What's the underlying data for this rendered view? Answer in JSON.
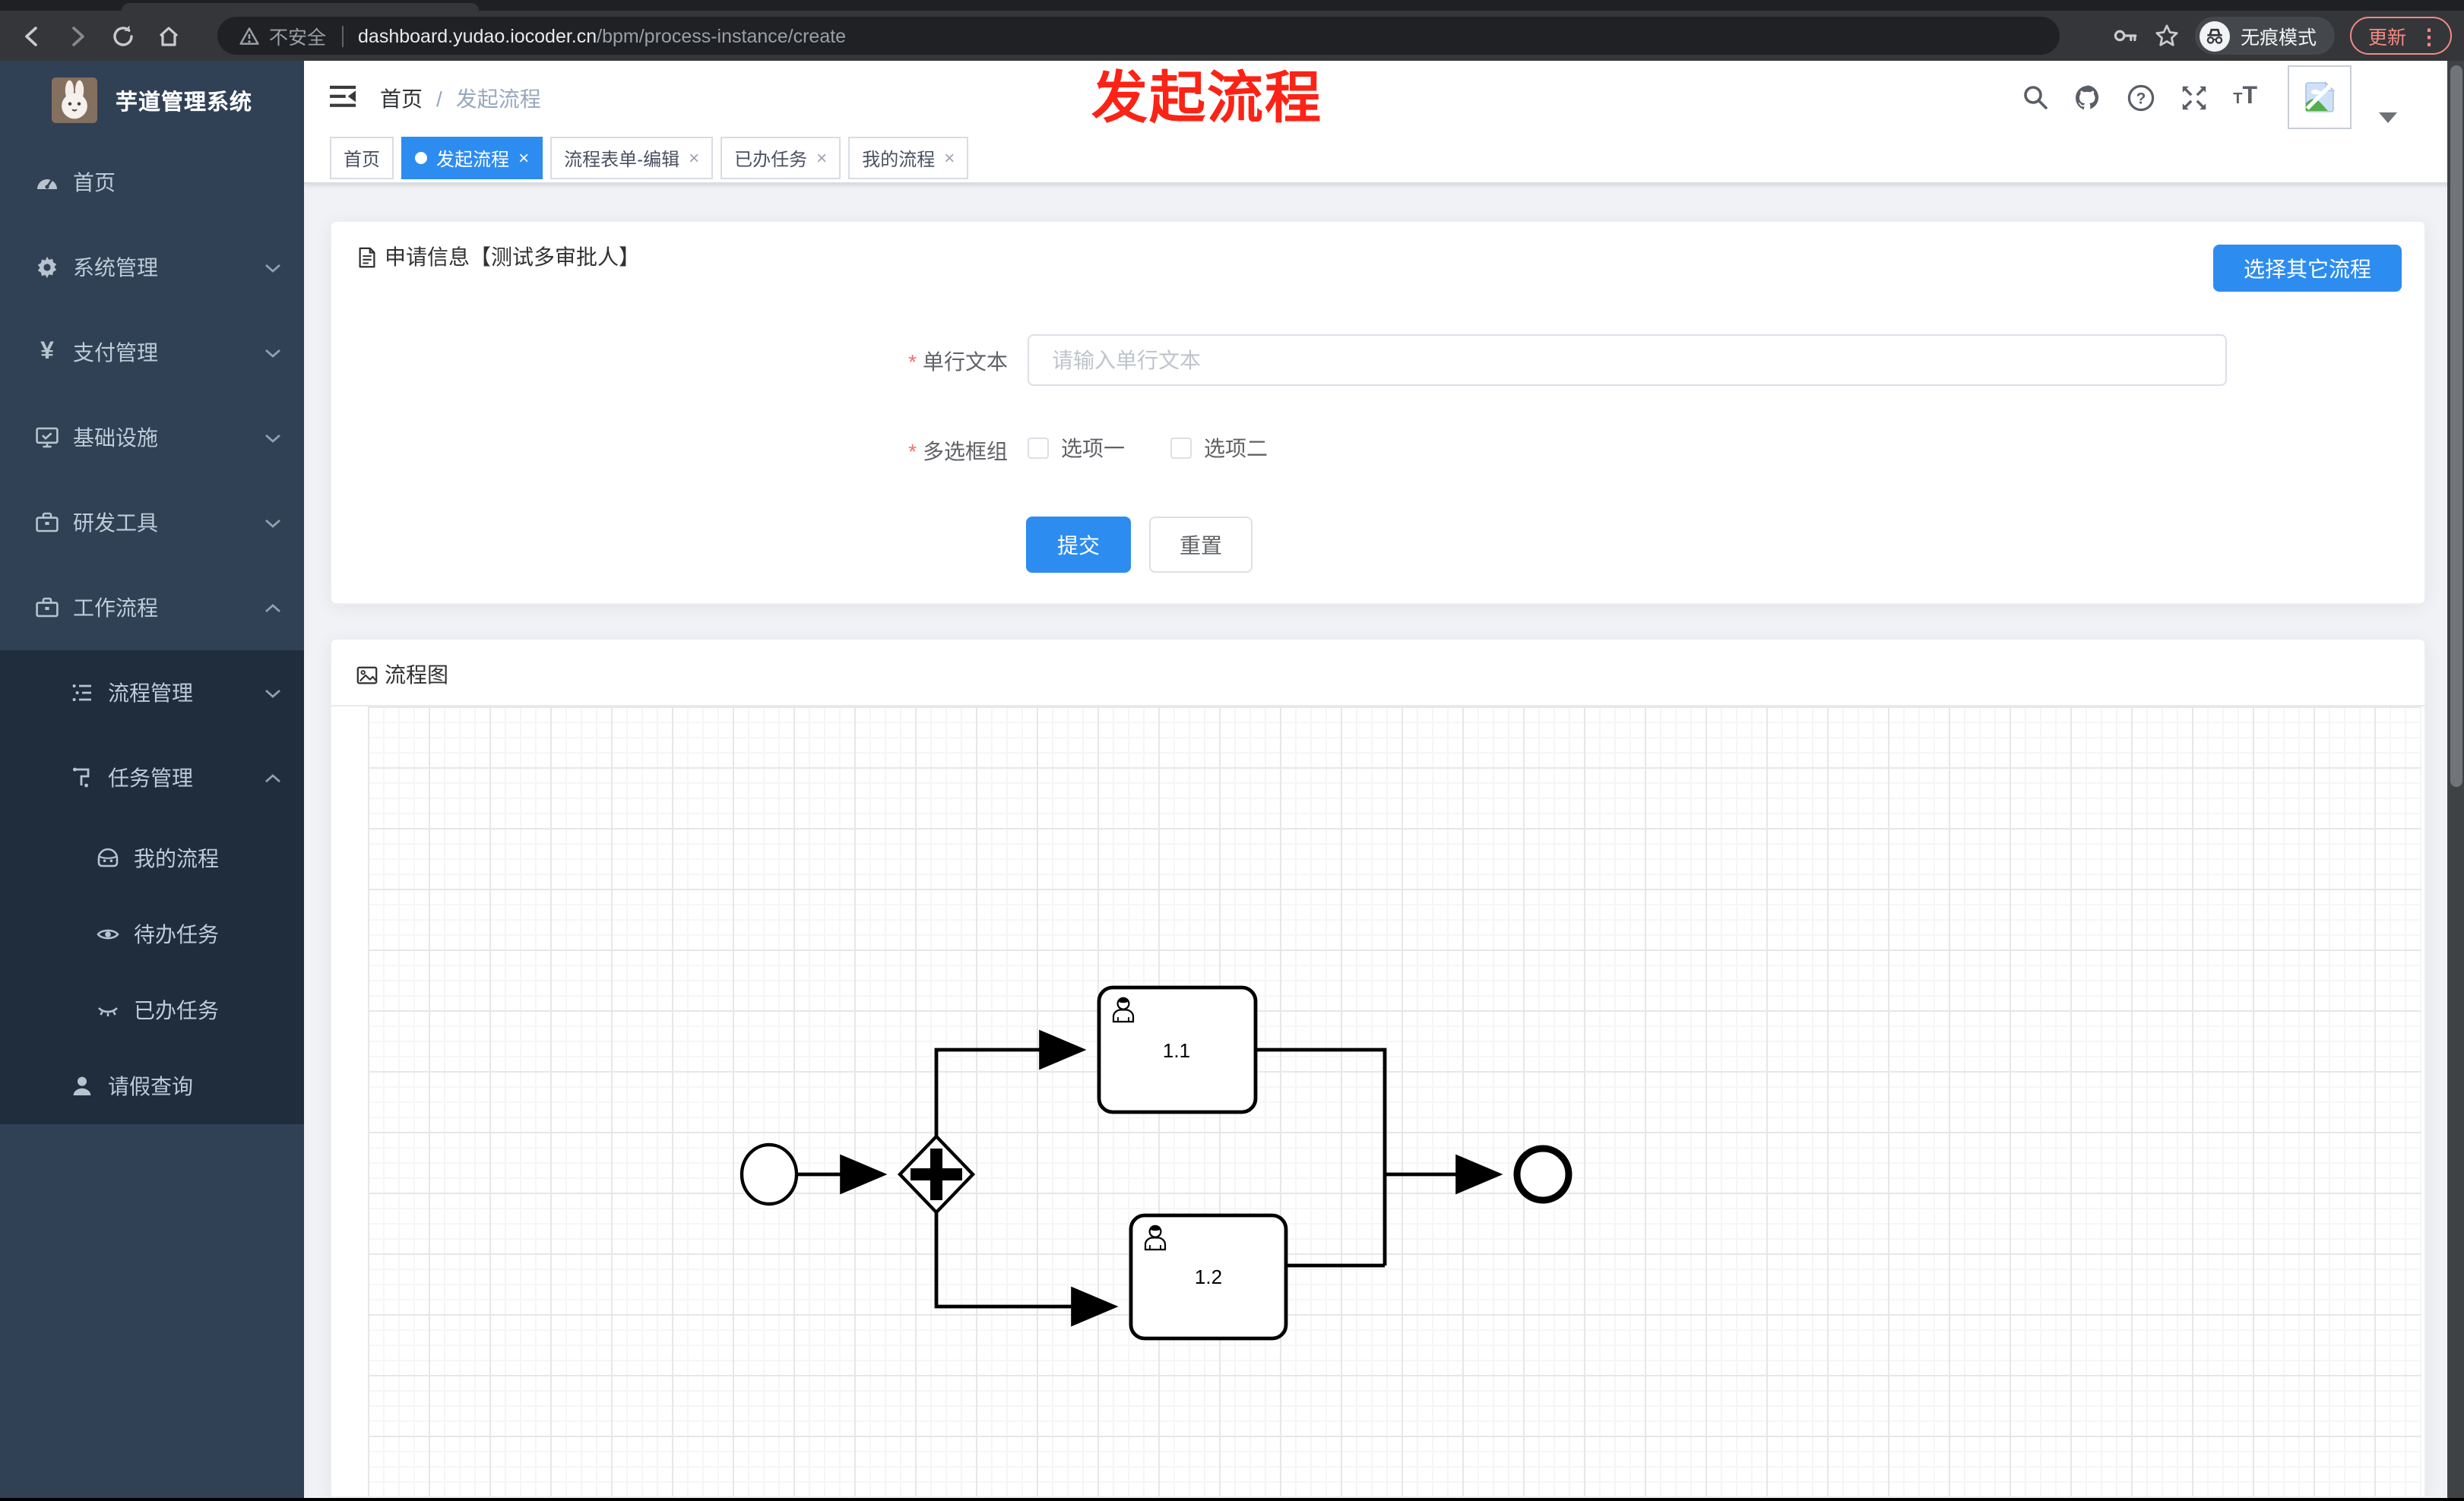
{
  "browser": {
    "security_label": "不安全",
    "url_host": "dashboard.yudao.iocoder.cn",
    "url_path": "/bpm/process-instance/create",
    "incognito_label": "无痕模式",
    "update_label": "更新"
  },
  "annotation": {
    "text": "发起流程",
    "color": "#fb2316"
  },
  "sidebar": {
    "app_title": "芋道管理系统",
    "items": [
      {
        "label": "首页",
        "level": 1
      },
      {
        "label": "系统管理",
        "level": 1,
        "state": "collapsed"
      },
      {
        "label": "支付管理",
        "level": 1,
        "state": "collapsed"
      },
      {
        "label": "基础设施",
        "level": 1,
        "state": "collapsed"
      },
      {
        "label": "研发工具",
        "level": 1,
        "state": "collapsed"
      },
      {
        "label": "工作流程",
        "level": 1,
        "state": "expanded"
      },
      {
        "label": "流程管理",
        "level": 2,
        "state": "collapsed"
      },
      {
        "label": "任务管理",
        "level": 2,
        "state": "expanded"
      },
      {
        "label": "我的流程",
        "level": 3
      },
      {
        "label": "待办任务",
        "level": 3
      },
      {
        "label": "已办任务",
        "level": 3
      },
      {
        "label": "请假查询",
        "level": 2
      }
    ]
  },
  "navbar": {
    "breadcrumb": {
      "home": "首页",
      "separator": "/",
      "current": "发起流程"
    }
  },
  "tabs": [
    {
      "label": "首页",
      "active": false,
      "closable": false
    },
    {
      "label": "发起流程",
      "active": true,
      "closable": true
    },
    {
      "label": "流程表单-编辑",
      "active": false,
      "closable": true
    },
    {
      "label": "已办任务",
      "active": false,
      "closable": true
    },
    {
      "label": "我的流程",
      "active": false,
      "closable": true
    }
  ],
  "apply_panel": {
    "title": "申请信息【测试多审批人】",
    "choose_other_label": "选择其它流程",
    "text_field": {
      "label": "单行文本",
      "required": true,
      "placeholder": "请输入单行文本",
      "value": ""
    },
    "checkbox_field": {
      "label": "多选框组",
      "required": true,
      "options": [
        {
          "label": "选项一",
          "checked": false
        },
        {
          "label": "选项二",
          "checked": false
        }
      ]
    },
    "submit_label": "提交",
    "reset_label": "重置"
  },
  "diagram_panel": {
    "title": "流程图",
    "bpmn": {
      "type": "bpmn-process",
      "start_event": "start",
      "gateway": "parallel-gateway",
      "tasks": [
        {
          "label": "1.1",
          "type": "user-task"
        },
        {
          "label": "1.2",
          "type": "user-task"
        }
      ],
      "end_event": "end",
      "flows": [
        "start→gateway",
        "gateway→1.1",
        "gateway→1.2",
        "1.1→end",
        "1.2→end"
      ]
    }
  },
  "colors": {
    "primary": "#2d8cf0",
    "sidebar_bg": "#304156",
    "submenu_bg": "#1f2d3d",
    "content_bg": "#f0f2f5",
    "annotation_red": "#fb2316",
    "update_chip": "#f28b82"
  }
}
